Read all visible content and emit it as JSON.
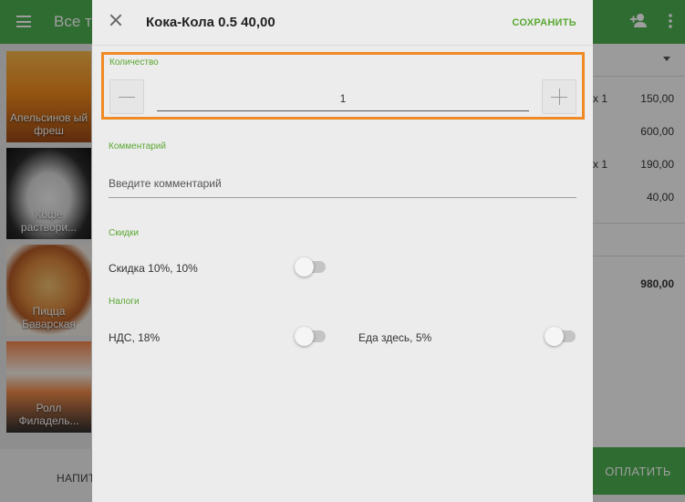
{
  "app": {
    "title": "Все то",
    "products": [
      {
        "label": "Апельсинов ый фреш",
        "color_top": "#f4a22b",
        "color_bottom": "#b0501d"
      },
      {
        "label": "Кофе раствори...",
        "color_top": "#222222",
        "color_bottom": "#6b4d36"
      },
      {
        "label": "Пицца Баварская",
        "color_top": "#e09a4a",
        "color_bottom": "#8e4f21"
      },
      {
        "label": "Ролл Филадель...",
        "color_top": "#f08a4a",
        "color_bottom": "#3c3c3c"
      }
    ],
    "bottom_tab": "НАПИТ",
    "pay_label": "ОПЛАТИТЬ",
    "order_lines": [
      {
        "qty": "x 1",
        "price": "150,00"
      },
      {
        "qty": "",
        "price": "600,00"
      },
      {
        "qty": "x 1",
        "price": "190,00"
      },
      {
        "qty": "",
        "price": "40,00"
      }
    ],
    "order_total": "980,00"
  },
  "dialog": {
    "title": "Кока-Кола 0.5 40,00",
    "save_label": "СОХРАНИТЬ",
    "quantity": {
      "label": "Количество",
      "value": "1"
    },
    "comment": {
      "label": "Комментарий",
      "placeholder": "Введите комментарий"
    },
    "discounts": {
      "label": "Скидки",
      "items": [
        {
          "label": "Скидка 10%, 10%",
          "on": false
        }
      ]
    },
    "taxes": {
      "label": "Налоги",
      "items": [
        {
          "label": "НДС, 18%",
          "on": false
        },
        {
          "label": "Еда здесь, 5%",
          "on": false
        }
      ]
    }
  },
  "colors": {
    "accent_green": "#4caf50",
    "highlight_orange": "#f08a24"
  }
}
